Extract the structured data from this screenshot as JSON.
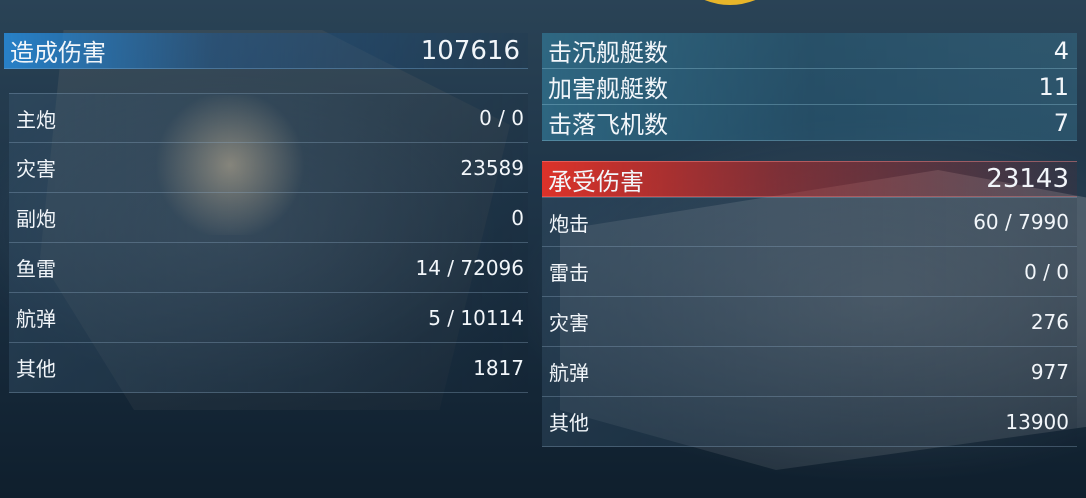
{
  "dealt": {
    "title": "造成伤害",
    "total": "107616",
    "rows": [
      {
        "label": "主炮",
        "value": "0 / 0"
      },
      {
        "label": "灾害",
        "value": "23589"
      },
      {
        "label": "副炮",
        "value": "0"
      },
      {
        "label": "鱼雷",
        "value": "14 / 72096"
      },
      {
        "label": "航弹",
        "value": "5 / 10114"
      },
      {
        "label": "其他",
        "value": "1817"
      }
    ]
  },
  "kills": [
    {
      "label": "击沉舰艇数",
      "value": "4"
    },
    {
      "label": "加害舰艇数",
      "value": "11"
    },
    {
      "label": "击落飞机数",
      "value": "7"
    }
  ],
  "received": {
    "title": "承受伤害",
    "total": "23143",
    "rows": [
      {
        "label": "炮击",
        "value": "60 / 7990"
      },
      {
        "label": "雷击",
        "value": "0 / 0"
      },
      {
        "label": "灾害",
        "value": "276"
      },
      {
        "label": "航弹",
        "value": "977"
      },
      {
        "label": "其他",
        "value": "13900"
      }
    ]
  },
  "colors": {
    "dealt_accent": "#2a8fdc",
    "received_accent": "#e2332a",
    "emblem": "#e8b62a"
  }
}
